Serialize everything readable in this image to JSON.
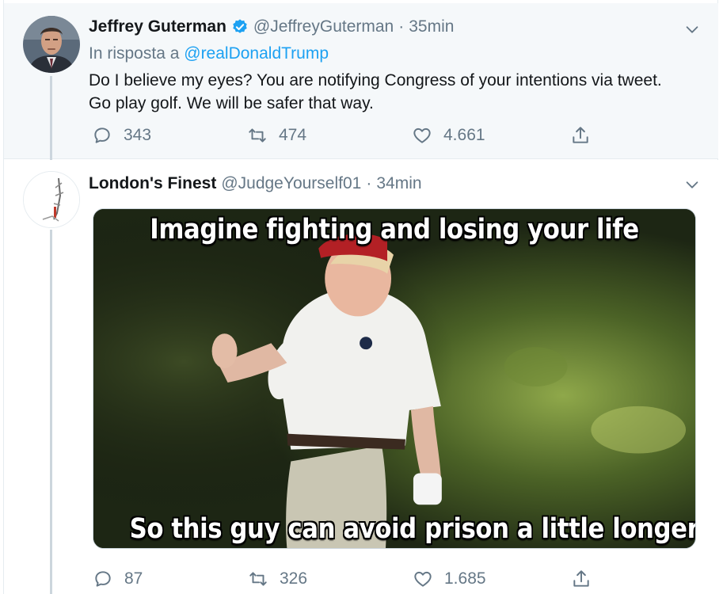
{
  "colors": {
    "accent": "#1da1f2",
    "muted": "#657786",
    "text": "#14171a",
    "selected_bg": "#f5f8fa"
  },
  "tweets": [
    {
      "author_name": "Jeffrey Guterman",
      "verified": true,
      "handle": "@JeffreyGuterman",
      "separator": "·",
      "time": "35min",
      "reply_prefix": "In risposta a",
      "reply_mention": "@realDonaldTrump",
      "text": "Do I believe my eyes? You are notifying Congress of your intentions via tweet. Go play golf. We will be safer that way.",
      "replies": "343",
      "retweets": "474",
      "likes": "4.661"
    },
    {
      "author_name": "London's Finest",
      "verified": false,
      "handle": "@JudgeYourself01",
      "separator": "·",
      "time": "34min",
      "media": {
        "top_caption": "Imagine fighting and losing your life",
        "bottom_caption": "So this guy can avoid prison a little longer"
      },
      "replies": "87",
      "retweets": "326",
      "likes": "1.685"
    }
  ],
  "icons": {
    "verified": "verified-badge-icon",
    "caret": "chevron-down-icon",
    "reply": "reply-bubble-icon",
    "retweet": "retweet-icon",
    "like": "heart-icon",
    "share": "share-icon"
  }
}
